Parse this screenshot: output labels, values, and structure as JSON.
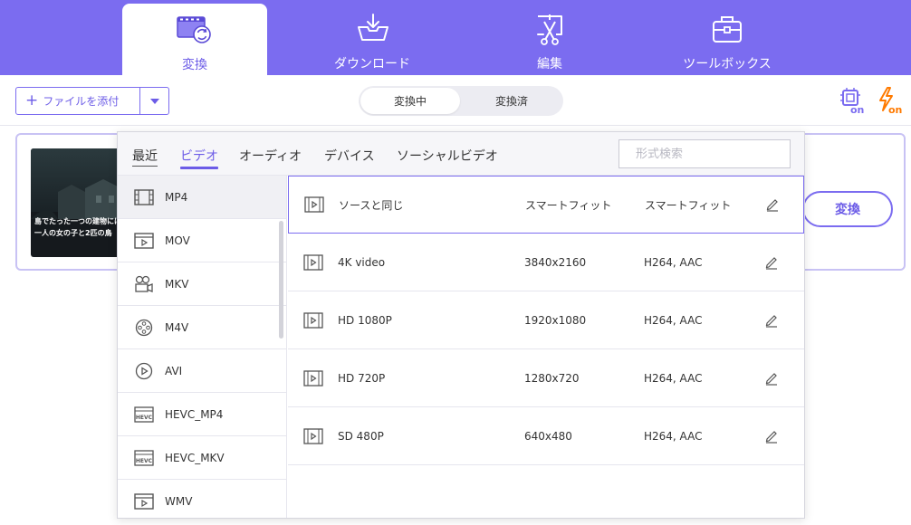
{
  "nav": {
    "tabs": [
      {
        "label": "変換",
        "icon": "convert-film-icon",
        "active": true
      },
      {
        "label": "ダウンロード",
        "icon": "download-tray-icon",
        "active": false
      },
      {
        "label": "編集",
        "icon": "scissors-edit-icon",
        "active": false
      },
      {
        "label": "ツールボックス",
        "icon": "toolbox-icon",
        "active": false
      }
    ],
    "accent_color": "#7b6cf0",
    "active_text_color": "#6c5ce7"
  },
  "toolbar": {
    "add_file_label": "ファイルを添付",
    "segment": {
      "converting": "変換中",
      "converted": "変換済",
      "selected": "変換中"
    },
    "gpu_icon_text": "on",
    "speed_icon_text": "on"
  },
  "file_card": {
    "subtitle_line1": "島でたった一つの建物には",
    "subtitle_line2": "一人の女の子と2匹の鳥",
    "convert_label": "変換"
  },
  "popup": {
    "categories": [
      "最近",
      "ビデオ",
      "オーディオ",
      "デバイス",
      "ソーシャルビデオ"
    ],
    "active_category": "ビデオ",
    "search_placeholder": "形式検索",
    "formats": [
      {
        "label": "MP4",
        "icon": "film-icon",
        "selected": true
      },
      {
        "label": "MOV",
        "icon": "film-play-icon"
      },
      {
        "label": "MKV",
        "icon": "camera-icon"
      },
      {
        "label": "M4V",
        "icon": "film-reel-icon"
      },
      {
        "label": "AVI",
        "icon": "play-circle-icon"
      },
      {
        "label": "HEVC_MP4",
        "icon": "hevc-icon"
      },
      {
        "label": "HEVC_MKV",
        "icon": "hevc-icon"
      },
      {
        "label": "WMV",
        "icon": "film-play-icon"
      }
    ],
    "presets": [
      {
        "name": "ソースと同じ",
        "resolution": "スマートフィット",
        "codec": "スマートフィット",
        "selected": true
      },
      {
        "name": "4K video",
        "resolution": "3840x2160",
        "codec": "H264, AAC"
      },
      {
        "name": "HD 1080P",
        "resolution": "1920x1080",
        "codec": "H264, AAC"
      },
      {
        "name": "HD 720P",
        "resolution": "1280x720",
        "codec": "H264, AAC"
      },
      {
        "name": "SD 480P",
        "resolution": "640x480",
        "codec": "H264, AAC"
      }
    ]
  }
}
